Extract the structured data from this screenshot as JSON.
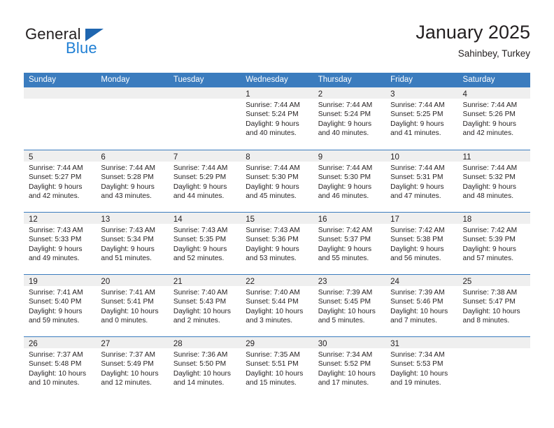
{
  "branding": {
    "name_dark": "General",
    "name_light": "Blue",
    "flag_icon": "triangle-flag-icon",
    "accent_color": "#1f7fd4",
    "flag_color": "#1f66b0"
  },
  "header": {
    "title": "January 2025",
    "subtitle": "Sahinbey, Turkey"
  },
  "calendar": {
    "header_bg": "#3b7cbe",
    "header_text_color": "#ffffff",
    "datebar_bg": "#efefef",
    "weekdays": [
      "Sunday",
      "Monday",
      "Tuesday",
      "Wednesday",
      "Thursday",
      "Friday",
      "Saturday"
    ],
    "weeks": [
      [
        {
          "day": "",
          "empty": true,
          "lines": []
        },
        {
          "day": "",
          "empty": true,
          "lines": []
        },
        {
          "day": "",
          "empty": true,
          "lines": []
        },
        {
          "day": "1",
          "empty": false,
          "lines": [
            "Sunrise: 7:44 AM",
            "Sunset: 5:24 PM",
            "Daylight: 9 hours",
            "and 40 minutes."
          ]
        },
        {
          "day": "2",
          "empty": false,
          "lines": [
            "Sunrise: 7:44 AM",
            "Sunset: 5:24 PM",
            "Daylight: 9 hours",
            "and 40 minutes."
          ]
        },
        {
          "day": "3",
          "empty": false,
          "lines": [
            "Sunrise: 7:44 AM",
            "Sunset: 5:25 PM",
            "Daylight: 9 hours",
            "and 41 minutes."
          ]
        },
        {
          "day": "4",
          "empty": false,
          "lines": [
            "Sunrise: 7:44 AM",
            "Sunset: 5:26 PM",
            "Daylight: 9 hours",
            "and 42 minutes."
          ]
        }
      ],
      [
        {
          "day": "5",
          "empty": false,
          "lines": [
            "Sunrise: 7:44 AM",
            "Sunset: 5:27 PM",
            "Daylight: 9 hours",
            "and 42 minutes."
          ]
        },
        {
          "day": "6",
          "empty": false,
          "lines": [
            "Sunrise: 7:44 AM",
            "Sunset: 5:28 PM",
            "Daylight: 9 hours",
            "and 43 minutes."
          ]
        },
        {
          "day": "7",
          "empty": false,
          "lines": [
            "Sunrise: 7:44 AM",
            "Sunset: 5:29 PM",
            "Daylight: 9 hours",
            "and 44 minutes."
          ]
        },
        {
          "day": "8",
          "empty": false,
          "lines": [
            "Sunrise: 7:44 AM",
            "Sunset: 5:30 PM",
            "Daylight: 9 hours",
            "and 45 minutes."
          ]
        },
        {
          "day": "9",
          "empty": false,
          "lines": [
            "Sunrise: 7:44 AM",
            "Sunset: 5:30 PM",
            "Daylight: 9 hours",
            "and 46 minutes."
          ]
        },
        {
          "day": "10",
          "empty": false,
          "lines": [
            "Sunrise: 7:44 AM",
            "Sunset: 5:31 PM",
            "Daylight: 9 hours",
            "and 47 minutes."
          ]
        },
        {
          "day": "11",
          "empty": false,
          "lines": [
            "Sunrise: 7:44 AM",
            "Sunset: 5:32 PM",
            "Daylight: 9 hours",
            "and 48 minutes."
          ]
        }
      ],
      [
        {
          "day": "12",
          "empty": false,
          "lines": [
            "Sunrise: 7:43 AM",
            "Sunset: 5:33 PM",
            "Daylight: 9 hours",
            "and 49 minutes."
          ]
        },
        {
          "day": "13",
          "empty": false,
          "lines": [
            "Sunrise: 7:43 AM",
            "Sunset: 5:34 PM",
            "Daylight: 9 hours",
            "and 51 minutes."
          ]
        },
        {
          "day": "14",
          "empty": false,
          "lines": [
            "Sunrise: 7:43 AM",
            "Sunset: 5:35 PM",
            "Daylight: 9 hours",
            "and 52 minutes."
          ]
        },
        {
          "day": "15",
          "empty": false,
          "lines": [
            "Sunrise: 7:43 AM",
            "Sunset: 5:36 PM",
            "Daylight: 9 hours",
            "and 53 minutes."
          ]
        },
        {
          "day": "16",
          "empty": false,
          "lines": [
            "Sunrise: 7:42 AM",
            "Sunset: 5:37 PM",
            "Daylight: 9 hours",
            "and 55 minutes."
          ]
        },
        {
          "day": "17",
          "empty": false,
          "lines": [
            "Sunrise: 7:42 AM",
            "Sunset: 5:38 PM",
            "Daylight: 9 hours",
            "and 56 minutes."
          ]
        },
        {
          "day": "18",
          "empty": false,
          "lines": [
            "Sunrise: 7:42 AM",
            "Sunset: 5:39 PM",
            "Daylight: 9 hours",
            "and 57 minutes."
          ]
        }
      ],
      [
        {
          "day": "19",
          "empty": false,
          "lines": [
            "Sunrise: 7:41 AM",
            "Sunset: 5:40 PM",
            "Daylight: 9 hours",
            "and 59 minutes."
          ]
        },
        {
          "day": "20",
          "empty": false,
          "lines": [
            "Sunrise: 7:41 AM",
            "Sunset: 5:41 PM",
            "Daylight: 10 hours",
            "and 0 minutes."
          ]
        },
        {
          "day": "21",
          "empty": false,
          "lines": [
            "Sunrise: 7:40 AM",
            "Sunset: 5:43 PM",
            "Daylight: 10 hours",
            "and 2 minutes."
          ]
        },
        {
          "day": "22",
          "empty": false,
          "lines": [
            "Sunrise: 7:40 AM",
            "Sunset: 5:44 PM",
            "Daylight: 10 hours",
            "and 3 minutes."
          ]
        },
        {
          "day": "23",
          "empty": false,
          "lines": [
            "Sunrise: 7:39 AM",
            "Sunset: 5:45 PM",
            "Daylight: 10 hours",
            "and 5 minutes."
          ]
        },
        {
          "day": "24",
          "empty": false,
          "lines": [
            "Sunrise: 7:39 AM",
            "Sunset: 5:46 PM",
            "Daylight: 10 hours",
            "and 7 minutes."
          ]
        },
        {
          "day": "25",
          "empty": false,
          "lines": [
            "Sunrise: 7:38 AM",
            "Sunset: 5:47 PM",
            "Daylight: 10 hours",
            "and 8 minutes."
          ]
        }
      ],
      [
        {
          "day": "26",
          "empty": false,
          "lines": [
            "Sunrise: 7:37 AM",
            "Sunset: 5:48 PM",
            "Daylight: 10 hours",
            "and 10 minutes."
          ]
        },
        {
          "day": "27",
          "empty": false,
          "lines": [
            "Sunrise: 7:37 AM",
            "Sunset: 5:49 PM",
            "Daylight: 10 hours",
            "and 12 minutes."
          ]
        },
        {
          "day": "28",
          "empty": false,
          "lines": [
            "Sunrise: 7:36 AM",
            "Sunset: 5:50 PM",
            "Daylight: 10 hours",
            "and 14 minutes."
          ]
        },
        {
          "day": "29",
          "empty": false,
          "lines": [
            "Sunrise: 7:35 AM",
            "Sunset: 5:51 PM",
            "Daylight: 10 hours",
            "and 15 minutes."
          ]
        },
        {
          "day": "30",
          "empty": false,
          "lines": [
            "Sunrise: 7:34 AM",
            "Sunset: 5:52 PM",
            "Daylight: 10 hours",
            "and 17 minutes."
          ]
        },
        {
          "day": "31",
          "empty": false,
          "lines": [
            "Sunrise: 7:34 AM",
            "Sunset: 5:53 PM",
            "Daylight: 10 hours",
            "and 19 minutes."
          ]
        },
        {
          "day": "",
          "empty": true,
          "lines": []
        }
      ]
    ]
  }
}
